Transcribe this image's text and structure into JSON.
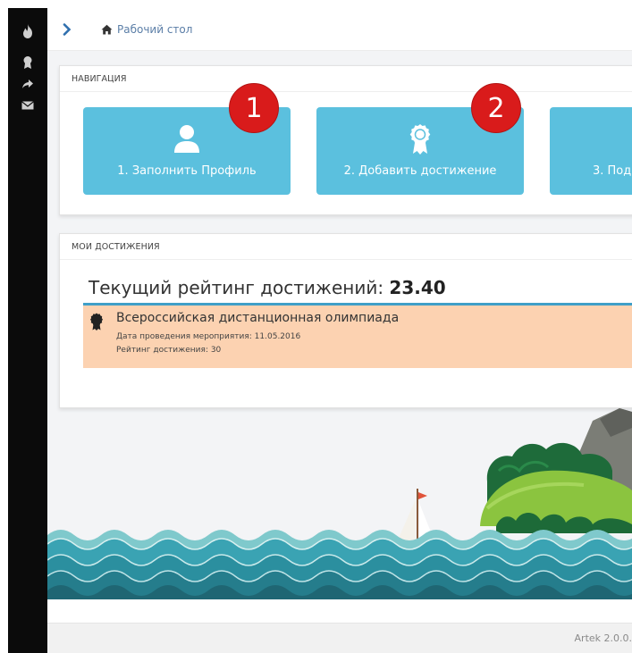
{
  "breadcrumb": {
    "home_label": "Рабочий стол"
  },
  "nav_panel": {
    "heading": "НАВИГАЦИЯ",
    "tiles": [
      {
        "label": "1. Заполнить Профиль",
        "icon": "user-icon"
      },
      {
        "label": "2. Добавить достижение",
        "icon": "award-icon"
      },
      {
        "label": "3. Под",
        "icon": ""
      }
    ]
  },
  "annotations": [
    "1",
    "2"
  ],
  "achievements_panel": {
    "heading": "МОИ ДОСТИЖЕНИЯ",
    "rating_label": "Текущий рейтинг достижений:",
    "rating_value": "23.40",
    "items": [
      {
        "title": "Всероссийская дистанционная олимпиада",
        "date_line": "Дата проведения мероприятия: 11.05.2016",
        "rating_line": "Рейтинг достижения: 30"
      }
    ]
  },
  "footer": {
    "version": "Artek 2.0.0."
  },
  "sidebar": {
    "icons": [
      "fire-icon",
      "award-icon",
      "share-icon",
      "mail-icon"
    ]
  },
  "colors": {
    "sidebar": "#0b0b0b",
    "tile": "#5bc0de",
    "badge": "#d91b1b",
    "achievement_bg": "#fcd2b1",
    "rule": "#3f9fc8",
    "sea": "#3aa3b3"
  }
}
